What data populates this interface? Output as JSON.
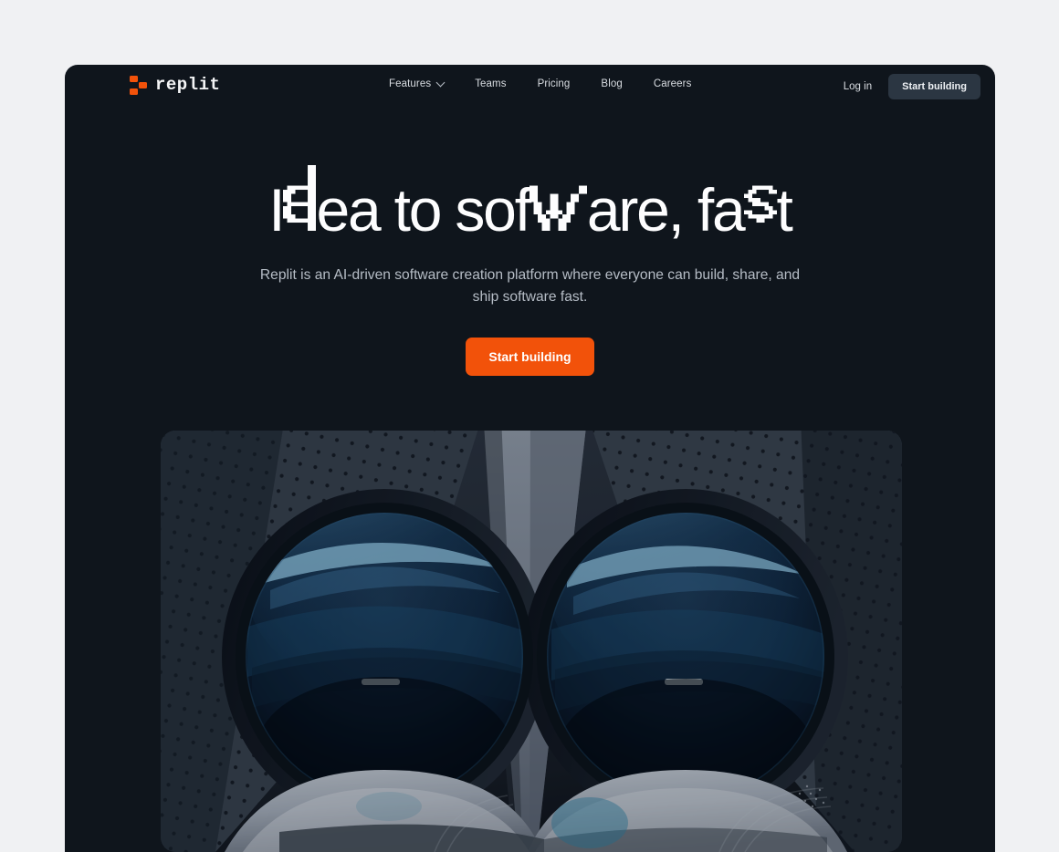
{
  "theme": {
    "page_bg": "#f0f1f3",
    "card_bg": "#0f151c",
    "accent_orange": "#f2520a",
    "nav_button_bg": "#2b3642",
    "text_primary": "#fdfdfe",
    "text_muted": "#b6bdc6"
  },
  "brand": {
    "name": "replit",
    "logo_icon": "replit-logo-icon"
  },
  "nav": {
    "items": [
      {
        "label": "Features",
        "has_dropdown": true,
        "icon": "chevron-down-icon"
      },
      {
        "label": "Teams",
        "has_dropdown": false
      },
      {
        "label": "Pricing",
        "has_dropdown": false
      },
      {
        "label": "Blog",
        "has_dropdown": false
      },
      {
        "label": "Careers",
        "has_dropdown": false
      }
    ],
    "login_label": "Log in",
    "cta_label": "Start building"
  },
  "hero": {
    "headline_parts": [
      {
        "text": "I",
        "style": "normal"
      },
      {
        "text": "d",
        "style": "glitch"
      },
      {
        "text": "ea to so",
        "style": "normal"
      },
      {
        "text": "f",
        "style": "normal"
      },
      {
        "text": "tw",
        "style": "glitch-w"
      },
      {
        "text": "are, fa",
        "style": "normal"
      },
      {
        "text": "s",
        "style": "glitch-s"
      },
      {
        "text": "t",
        "style": "normal"
      }
    ],
    "headline_plain": "Idea to software, fast",
    "subhead": "Replit is an AI-driven software creation platform where everyone can build, share, and ship software fast.",
    "cta_label": "Start building",
    "media_alt": "robot-face-closeup-image"
  }
}
